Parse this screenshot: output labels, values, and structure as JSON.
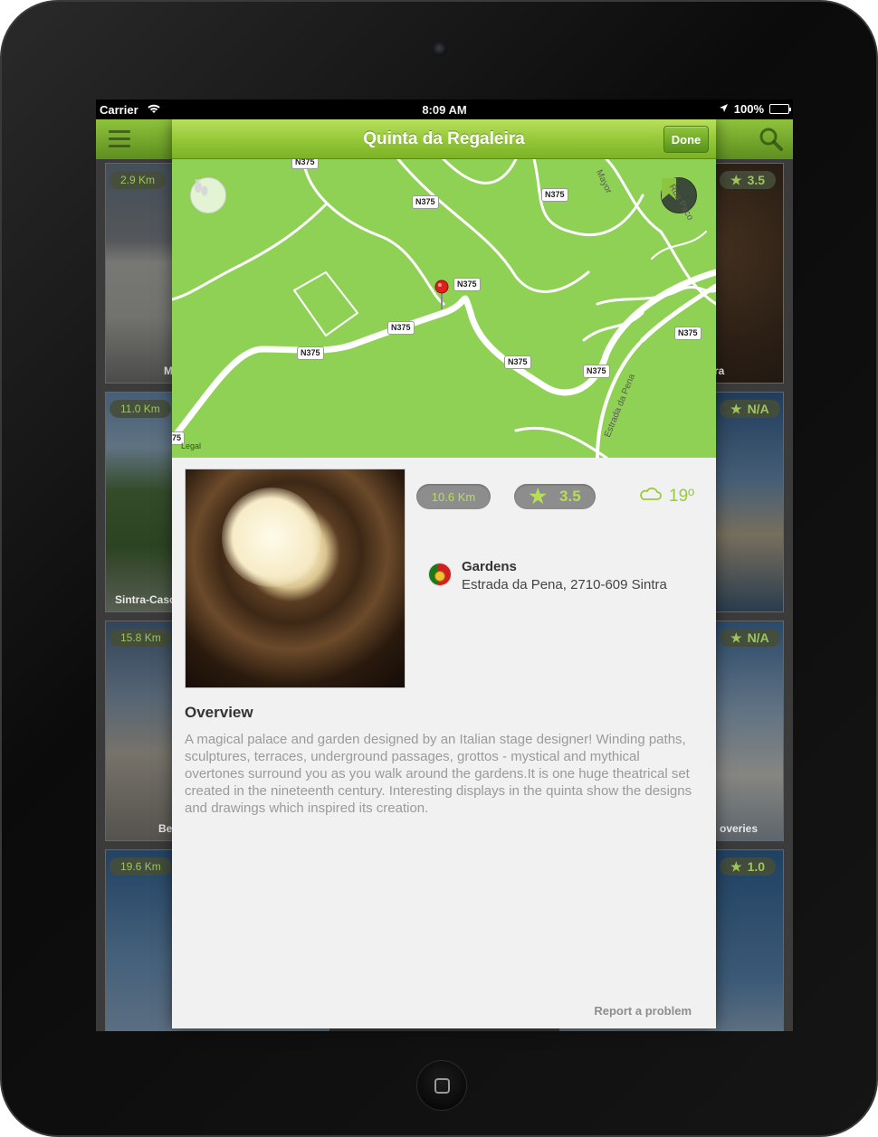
{
  "status_bar": {
    "carrier": "Carrier",
    "time": "8:09 AM",
    "battery": "100%"
  },
  "background": {
    "tiles": [
      {
        "distance": "2.9 Km",
        "caption": "M"
      },
      {
        "distance": "11.0 Km",
        "caption": "Sintra-Casc"
      },
      {
        "distance": "15.8 Km",
        "caption": "Bel"
      },
      {
        "distance": "19.6 Km",
        "caption": ""
      },
      {
        "rating": "3.5",
        "caption": "ra"
      },
      {
        "rating": "N/A",
        "caption": ""
      },
      {
        "rating": "N/A",
        "caption": "overies"
      },
      {
        "rating": "1.0",
        "caption": ""
      }
    ]
  },
  "modal": {
    "title": "Quinta da Regaleira",
    "done_label": "Done",
    "map": {
      "road_labels": [
        "N375",
        "N375",
        "N375",
        "N375",
        "N375",
        "N375",
        "N375",
        "N375",
        "N375",
        "75"
      ],
      "street_labels": [
        "Mayor",
        "Rua Paco",
        "Estrada da Pena"
      ],
      "legal": "Legal"
    },
    "distance": "10.6 Km",
    "rating": "3.5",
    "temperature": "19º",
    "category": "Gardens",
    "address": "Estrada da Pena, 2710-609 Sintra",
    "overview_title": "Overview",
    "overview_text": "A magical palace and garden designed by an Italian stage designer! Winding paths, sculptures, terraces, underground passages, grottos - mystical and mythical overtones surround you as you walk around the gardens.It is one huge theatrical set created in the nineteenth century. Interesting displays in the quinta show the designs and drawings which inspired its creation.",
    "report_label": "Report a problem"
  },
  "colors": {
    "accent_green": "#96c93a",
    "map_green": "#8fd155",
    "badge_text": "#b6df57"
  }
}
